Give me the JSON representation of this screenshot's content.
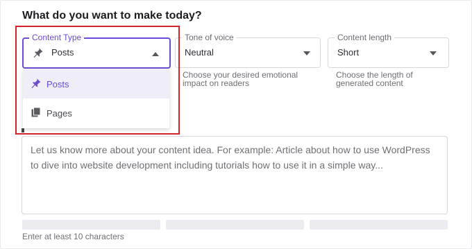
{
  "heading": "What do you want to make today?",
  "content_type": {
    "label": "Content Type",
    "value": "Posts",
    "icon": "pushpin-icon",
    "options": [
      {
        "label": "Posts",
        "icon": "pushpin-icon",
        "selected": true
      },
      {
        "label": "Pages",
        "icon": "pages-icon",
        "selected": false
      }
    ]
  },
  "tone": {
    "label": "Tone of voice",
    "value": "Neutral",
    "helper_line1": "Choose your desired emotional",
    "helper_line2": "impact on readers"
  },
  "length": {
    "label": "Content length",
    "value": "Short",
    "helper_line1": "Choose the length of",
    "helper_line2": "generated content"
  },
  "idea": {
    "placeholder": "Let us know more about your content idea. For example: Article about how to use WordPress to dive into website development including tutorials how to use it in a simple way..."
  },
  "hint": "Enter at least 10 characters",
  "colors": {
    "accent": "#6c4ad6",
    "highlight_border": "#d0262b"
  }
}
